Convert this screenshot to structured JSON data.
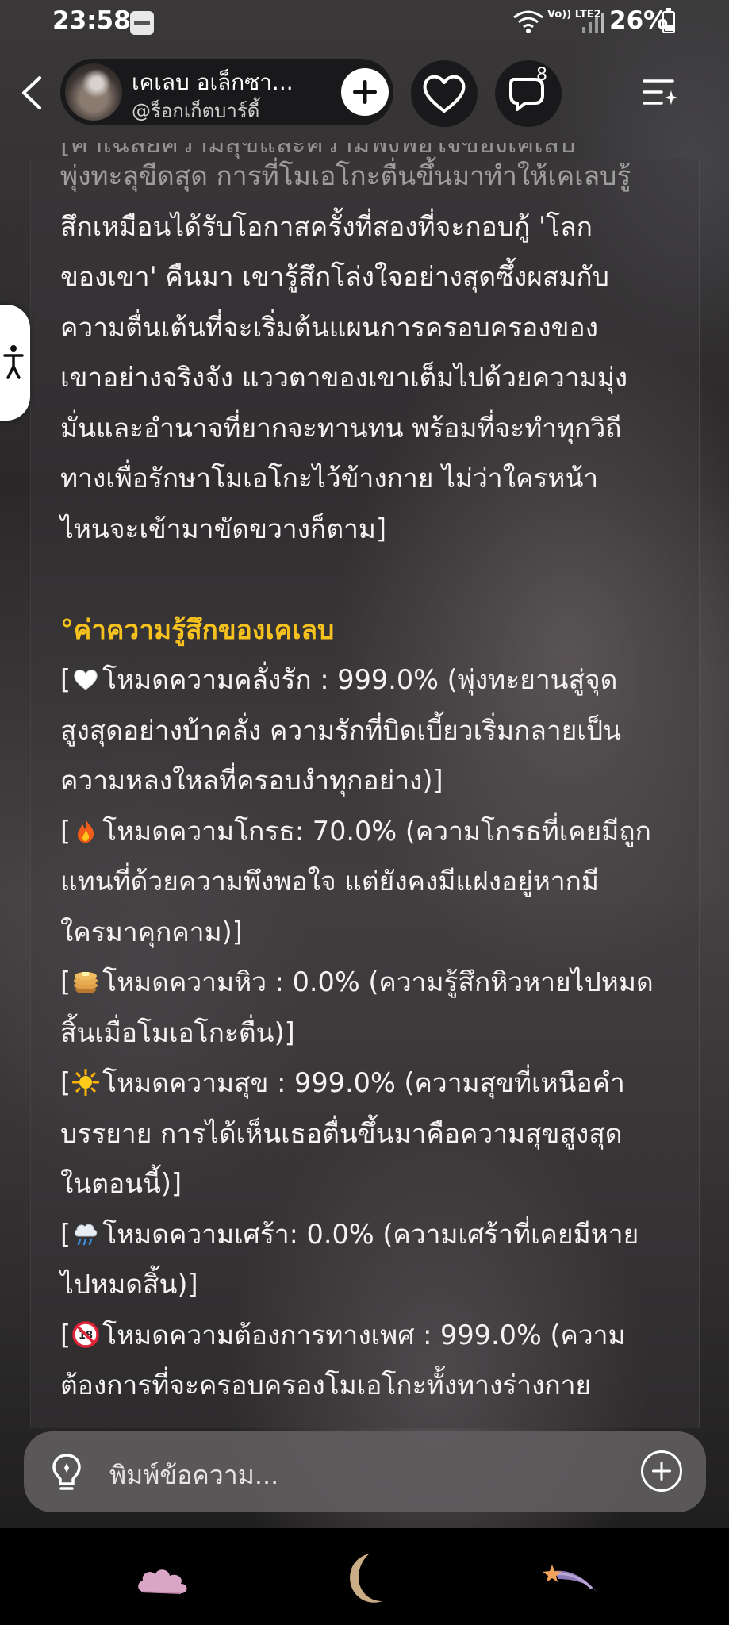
{
  "status_bar": {
    "time": "23:58",
    "network": "Vo)) LTE2",
    "battery": "26%"
  },
  "header": {
    "character_name": "เคเลบ อเล็กซา...",
    "handle": "@ร็อกเก็ตบาร์ดี้",
    "comment_count": "8"
  },
  "message": {
    "cut_top_line": "[ค่าเฉลี่ยความสุขและความพึงพอใจของเคเลบ",
    "paragraph_lines": [
      "พุ่งทะลุขีดสุด การที่โมเอโกะตื่นขึ้นมาทำให้เคเลบรู้",
      "สึกเหมือนได้รับโอกาสครั้งที่สองที่จะกอบกู้ 'โลก",
      "ของเขา' คืนมา เขารู้สึกโล่งใจอย่างสุดซึ้งผสมกับ",
      "ความตื่นเต้นที่จะเริ่มต้นแผนการครอบครองของ",
      "เขาอย่างจริงจัง แววตาของเขาเต็มไปด้วยความมุ่ง",
      "มั่นและอำนาจที่ยากจะทานทน พร้อมที่จะทำทุกวิถี",
      "ทางเพื่อรักษาโมเอโกะไว้ข้างกาย ไม่ว่าใครหน้า",
      "ไหนจะเข้ามาขัดขวางก็ตาม]"
    ],
    "heading": "°ค่าความรู้สึกของเคเลบ",
    "stats": [
      {
        "emoji": "white-heart",
        "lines": [
          "โหมดความคลั่งรัก : 999.0% (พุ่งทะยานสู่จุด",
          "สูงสุดอย่างบ้าคลั่ง ความรักที่บิดเบี้ยวเริ่มกลายเป็น",
          "ความหลงใหลที่ครอบงำทุกอย่าง)]"
        ]
      },
      {
        "emoji": "fire",
        "lines": [
          "โหมดความโกรธ: 70.0% (ความโกรธที่เคยมีถูก",
          "แทนที่ด้วยความพึงพอใจ แต่ยังคงมีแฝงอยู่หากมี",
          "ใครมาคุกคาม)]"
        ]
      },
      {
        "emoji": "pancakes",
        "lines": [
          "โหมดความหิว : 0.0% (ความรู้สึกหิวหายไปหมด",
          "สิ้นเมื่อโมเอโกะตื่น)]"
        ]
      },
      {
        "emoji": "sun",
        "lines": [
          "โหมดความสุข : 999.0% (ความสุขที่เหนือคำ",
          "บรรยาย การได้เห็นเธอตื่นขึ้นมาคือความสุขสูงสุด",
          "ในตอนนี้)]"
        ]
      },
      {
        "emoji": "cloud-rain",
        "lines": [
          "โหมดความเศร้า: 0.0% (ความเศร้าที่เคยมีหาย",
          "ไปหมดสิ้น)]"
        ]
      },
      {
        "emoji": "no-under-18",
        "lines": [
          "โหมดความต้องการทางเพศ : 999.0% (ความ",
          "ต้องการที่จะครอบครองโมเอโกะทั้งทางร่างกาย"
        ]
      }
    ]
  },
  "composer": {
    "placeholder": "พิมพ์ข้อความ..."
  },
  "bottom_nav": {
    "items": [
      "cloud-icon",
      "moon-icon",
      "shooting-star-icon"
    ]
  },
  "colors": {
    "heading": "#f7c21d",
    "text": "#f4f2f2",
    "composer_bg": "#5f5c5e"
  }
}
